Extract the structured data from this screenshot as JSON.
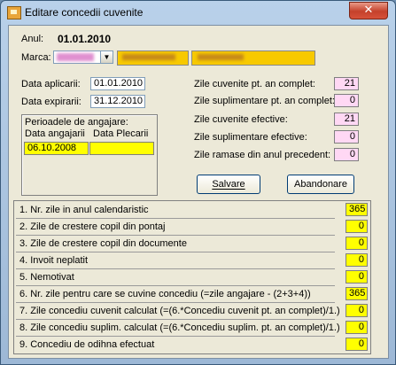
{
  "window": {
    "title": "Editare concedii cuvenite",
    "close_glyph": "✕"
  },
  "header": {
    "anul_label": "Anul:",
    "anul_value": "01.01.2010",
    "marca_label": "Marca:"
  },
  "dates": {
    "aplicarii_label": "Data aplicarii:",
    "aplicarii_value": "01.01.2010",
    "expirarii_label": "Data expirarii:",
    "expirarii_value": "31.12.2010"
  },
  "perioade": {
    "title": "Perioadele de angajare:",
    "col1": "Data angajarii",
    "col2": "Data Plecarii",
    "row_start": "06.10.2008",
    "row_end": ""
  },
  "summary": [
    {
      "label": "Zile cuvenite pt. an complet:",
      "value": "21"
    },
    {
      "label": "Zile suplimentare pt. an complet:",
      "value": "0"
    },
    {
      "label": "Zile cuvenite efective:",
      "value": "21"
    },
    {
      "label": "Zile suplimentare efective:",
      "value": "0"
    },
    {
      "label": "Zile ramase din anul precedent:",
      "value": "0"
    }
  ],
  "buttons": {
    "save": "Salvare",
    "cancel": "Abandonare"
  },
  "rows": [
    {
      "label": "1. Nr. zile in anul calendaristic",
      "value": "365"
    },
    {
      "label": "2. Zile de crestere copil din pontaj",
      "value": "0"
    },
    {
      "label": "3. Zile de crestere copil din documente",
      "value": "0"
    },
    {
      "label": "4. Invoit neplatit",
      "value": "0"
    },
    {
      "label": "5. Nemotivat",
      "value": "0"
    },
    {
      "label": "6. Nr. zile pentru care se cuvine concediu (=zile angajare - (2+3+4))",
      "value": "365"
    },
    {
      "label": "7. Zile concediu cuvenit calculat (=(6.*Concediu cuvenit pt. an complet)/1.)",
      "value": "0"
    },
    {
      "label": "8. Zile concediu suplim. calculat (=(6.*Concediu suplim. pt. an complet)/1.)",
      "value": "0"
    },
    {
      "label": "9. Concediu de odihna efectuat",
      "value": "0"
    }
  ],
  "colors": {
    "yellow_field": "#ffff00",
    "pink_field": "#ffd8f4",
    "dialog_bg": "#ece9d8"
  }
}
